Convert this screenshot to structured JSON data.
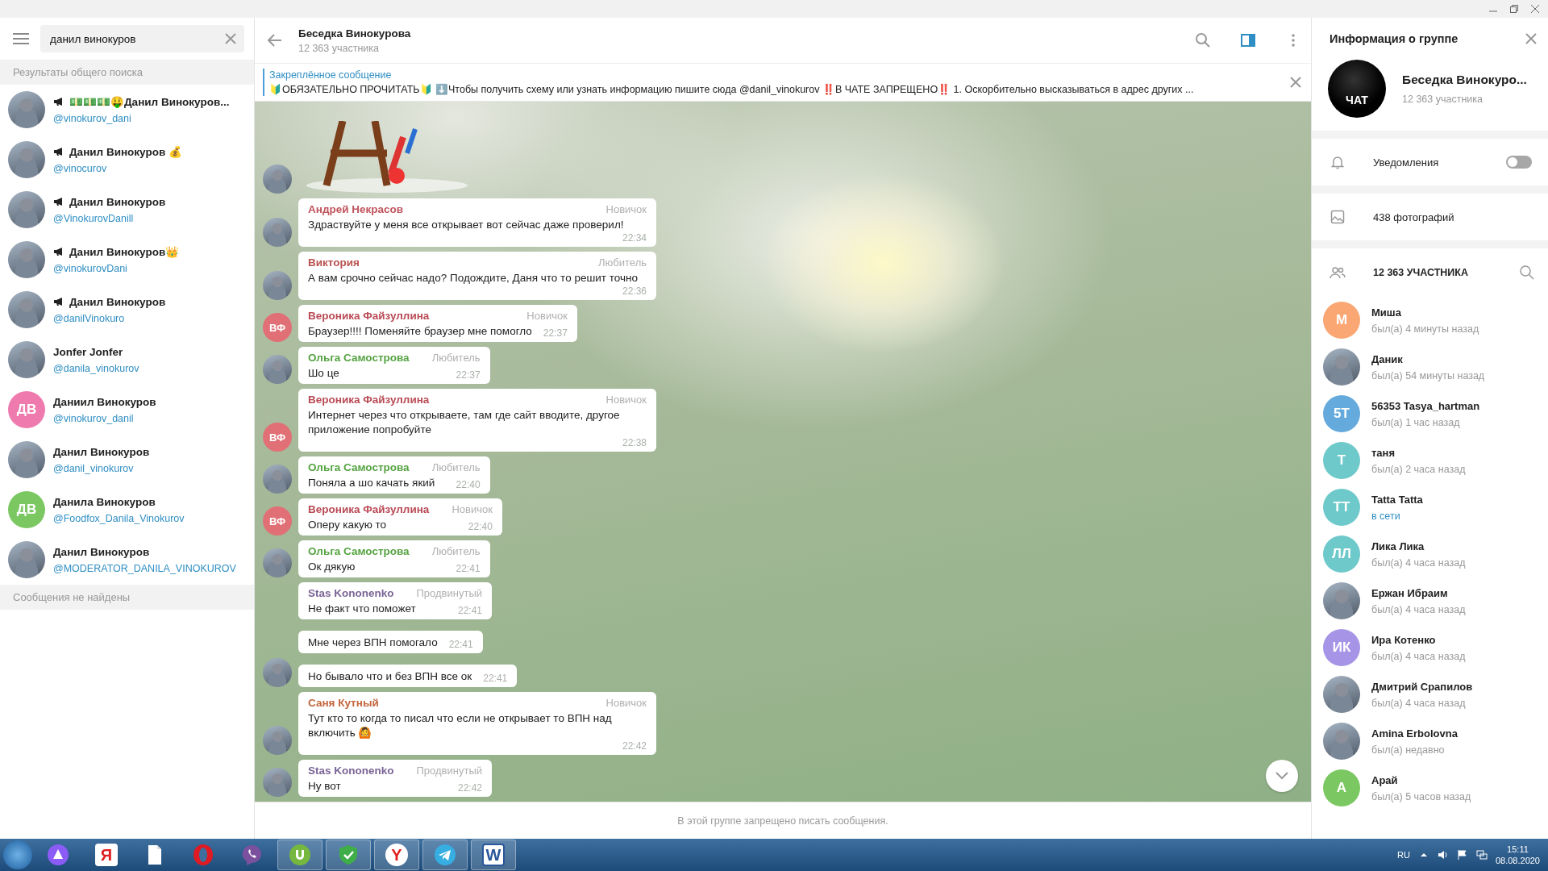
{
  "search": {
    "value": "данил винокуров"
  },
  "results_header": "Результаты общего поиска",
  "results": [
    {
      "kind": "channel",
      "name": "💵💵💵🤑Данил Винокуров...",
      "handle": "@vinokurov_dani",
      "avatar": {
        "kind": "photo"
      }
    },
    {
      "kind": "channel",
      "name": "Данил Винокуров 💰",
      "handle": "@vinocurov",
      "avatar": {
        "kind": "photo"
      }
    },
    {
      "kind": "channel",
      "name": "Данил Винокуров",
      "handle": "@VinokurovDanill",
      "avatar": {
        "kind": "photo"
      }
    },
    {
      "kind": "channel",
      "name": "Данил Винокуров👑",
      "handle": "@vinokurovDani",
      "avatar": {
        "kind": "photo"
      }
    },
    {
      "kind": "channel",
      "name": "Данил Винокуров",
      "handle": "@danilVinokuro",
      "avatar": {
        "kind": "photo"
      }
    },
    {
      "kind": "user",
      "name": "Jonfer Jonfer",
      "handle": "@danila_vinokurov",
      "avatar": {
        "kind": "photo"
      }
    },
    {
      "kind": "user",
      "name": "Даниил Винокуров",
      "handle": "@vinokurov_danil",
      "avatar": {
        "kind": "initials",
        "initials": "ДВ",
        "color": "#ee7aae"
      }
    },
    {
      "kind": "user",
      "name": "Данил Винокуров",
      "handle": "@danil_vinokurov",
      "avatar": {
        "kind": "photo"
      }
    },
    {
      "kind": "user",
      "name": "Данила Винокуров",
      "handle": "@Foodfox_Danila_Vinokurov",
      "avatar": {
        "kind": "initials",
        "initials": "ДВ",
        "color": "#7bc862"
      }
    },
    {
      "kind": "user",
      "name": "Данил Винокуров",
      "handle": "@MODERATOR_DANILA_VINOKUROV",
      "avatar": {
        "kind": "photo"
      }
    }
  ],
  "no_messages": "Сообщения не найдены",
  "chat": {
    "title": "Беседка Винокурова",
    "subtitle": "12 363 участника",
    "pinned": {
      "label": "Закреплённое сообщение",
      "text": "🔰ОБЯЗАТЕЛЬНО ПРОЧИТАТЬ🔰 ⬇️Чтобы получить схему или узнать информацию пишите сюда @danil_vinokurov  ‼️В ЧАТЕ ЗАПРЕЩЕНО‼️ 1. Оскорбительно высказываться в адрес других ..."
    },
    "messages": [
      {
        "kind": "sticker",
        "avatar": {
          "kind": "photo"
        }
      },
      {
        "kind": "text",
        "author": "Андрей Некрасов",
        "color": "#c0545c",
        "role": "Новичок",
        "text": "Здраствуйте у меня все открывает вот сейчас даже проверил!",
        "time": "22:34",
        "avatar": {
          "kind": "photo"
        }
      },
      {
        "kind": "text",
        "author": "Виктория",
        "color": "#b8514f",
        "role": "Любитель",
        "text": "А вам срочно сейчас надо? Подождите, Даня что то решит точно",
        "time": "22:36",
        "avatar": {
          "kind": "photo"
        }
      },
      {
        "kind": "text",
        "author": "Вероника Файзуллина",
        "color": "#b94a55",
        "role": "Новичок",
        "text": "Браузер!!!! Поменяйте браузер мне помогло",
        "time": "22:37",
        "avatar": {
          "kind": "initials",
          "initials": "ВФ",
          "color": "#e17076"
        }
      },
      {
        "kind": "text",
        "author": "Ольга Самострова",
        "color": "#56a342",
        "role": "Любитель",
        "text": "Шо це",
        "time": "22:37",
        "avatar": {
          "kind": "photo"
        }
      },
      {
        "kind": "text",
        "author": "Вероника Файзуллина",
        "color": "#b94a55",
        "role": "Новичок",
        "text": "Интернет через что открываете, там где сайт вводите, другое приложение попробуйте",
        "time": "22:38",
        "avatar": {
          "kind": "initials",
          "initials": "ВФ",
          "color": "#e17076"
        }
      },
      {
        "kind": "text",
        "author": "Ольга Самострова",
        "color": "#56a342",
        "role": "Любитель",
        "text": "Поняла а шо качать який",
        "time": "22:40",
        "avatar": {
          "kind": "photo"
        }
      },
      {
        "kind": "text",
        "author": "Вероника Файзуллина",
        "color": "#b94a55",
        "role": "Новичок",
        "text": "Оперу какую то",
        "time": "22:40",
        "avatar": {
          "kind": "initials",
          "initials": "ВФ",
          "color": "#e17076"
        }
      },
      {
        "kind": "text",
        "author": "Ольга Самострова",
        "color": "#56a342",
        "role": "Любитель",
        "text": "Ок дякую",
        "time": "22:41",
        "avatar": {
          "kind": "photo"
        }
      },
      {
        "kind": "text",
        "author": "Stas Kononenko",
        "color": "#7a6596",
        "role": "Продвинутый",
        "text": "Не факт что поможет",
        "time": "22:41"
      },
      {
        "kind": "text",
        "text": "Мне через ВПН помогало",
        "time": "22:41"
      },
      {
        "kind": "text",
        "text": "Но бывало что и без ВПН все ок",
        "time": "22:41",
        "avatar": {
          "kind": "photo"
        }
      },
      {
        "kind": "text",
        "author": "Саня Кутный",
        "color": "#c2653c",
        "role": "Новичок",
        "text": "Тут кто то когда то писал что если не открывает то ВПН над включить 🙆",
        "time": "22:42",
        "avatar": {
          "kind": "photo"
        }
      },
      {
        "kind": "text",
        "author": "Stas Kononenko",
        "color": "#7a6596",
        "role": "Продвинутый",
        "text": "Ну вот",
        "time": "22:42",
        "avatar": {
          "kind": "photo"
        }
      }
    ],
    "footer": "В этой группе запрещено писать сообщения."
  },
  "info": {
    "title": "Информация о группе",
    "name": "Беседка Винокуро...",
    "count": "12 363 участника",
    "logo_text": "ЧАТ",
    "notifications": {
      "label": "Уведомления",
      "on": false
    },
    "photos": "438 фотографий",
    "members_header": "12 363 УЧАСТНИКА",
    "members": [
      {
        "name": "Миша",
        "status": "был(а) 4 минуты назад",
        "online": false,
        "avatar": {
          "kind": "initials",
          "initials": "М",
          "color": "#faa774"
        }
      },
      {
        "name": "Даник",
        "status": "был(а) 54 минуты назад",
        "online": false,
        "avatar": {
          "kind": "photo"
        }
      },
      {
        "name": "56353 Tasya_hartman",
        "status": "был(а) 1 час назад",
        "online": false,
        "avatar": {
          "kind": "initials",
          "initials": "5T",
          "color": "#65aadd"
        }
      },
      {
        "name": "таня",
        "status": "был(а) 2 часа назад",
        "online": false,
        "avatar": {
          "kind": "initials",
          "initials": "Т",
          "color": "#6ec9cb"
        }
      },
      {
        "name": "Tatta Tatta",
        "status": "в сети",
        "online": true,
        "avatar": {
          "kind": "initials",
          "initials": "TT",
          "color": "#6ec9cb"
        }
      },
      {
        "name": "Лика Лика",
        "status": "был(а) 4 часа назад",
        "online": false,
        "avatar": {
          "kind": "initials",
          "initials": "ЛЛ",
          "color": "#6ec9cb"
        }
      },
      {
        "name": "Ержан Ибраим",
        "status": "был(а) 4 часа назад",
        "online": false,
        "avatar": {
          "kind": "photo"
        }
      },
      {
        "name": "Ира Котенко",
        "status": "был(а) 4 часа назад",
        "online": false,
        "avatar": {
          "kind": "initials",
          "initials": "ИК",
          "color": "#a695e7"
        }
      },
      {
        "name": "Дмитрий Срапилов",
        "status": "был(а) 4 часа назад",
        "online": false,
        "avatar": {
          "kind": "photo"
        }
      },
      {
        "name": "Amina Erbolovna",
        "status": "был(а) недавно",
        "online": false,
        "avatar": {
          "kind": "photo"
        }
      },
      {
        "name": "Арай",
        "status": "был(а) 5 часов назад",
        "online": false,
        "avatar": {
          "kind": "initials",
          "initials": "А",
          "color": "#7bc862"
        }
      }
    ]
  },
  "taskbar": {
    "apps": [
      {
        "kind": "assistant",
        "open": false
      },
      {
        "kind": "yandex",
        "glyph": "Я",
        "open": false
      },
      {
        "kind": "file",
        "open": false
      },
      {
        "kind": "opera",
        "open": false
      },
      {
        "kind": "viber",
        "open": false
      },
      {
        "kind": "torrent",
        "open": true
      },
      {
        "kind": "shield",
        "open": true
      },
      {
        "kind": "browser",
        "glyph": "Y",
        "open": true
      },
      {
        "kind": "telegram",
        "open": true
      },
      {
        "kind": "word",
        "glyph": "W",
        "open": true
      }
    ],
    "language": "RU",
    "time": "15:11",
    "date": "08.08.2020"
  }
}
